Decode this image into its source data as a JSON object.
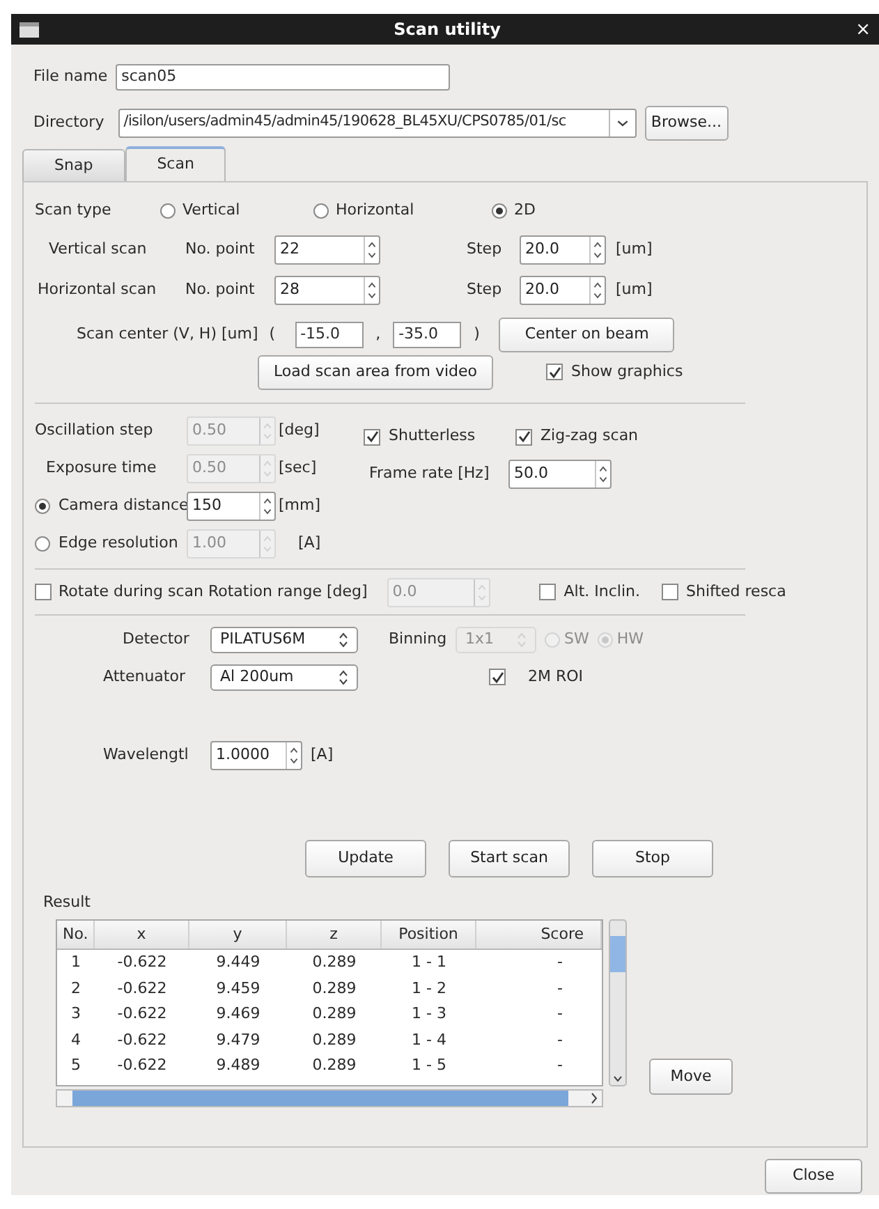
{
  "window": {
    "title": "Scan utility",
    "close": "×"
  },
  "file_name": {
    "label": "File name",
    "value": "scan05"
  },
  "directory": {
    "label": "Directory",
    "value": "/isilon/users/admin45/admin45/190628_BL45XU/CPS0785/01/sc",
    "browse": "Browse..."
  },
  "tabs": [
    {
      "label": "Snap",
      "selected": false
    },
    {
      "label": "Scan",
      "selected": true
    }
  ],
  "scan_type": {
    "label": "Scan type",
    "options": [
      {
        "label": "Vertical",
        "selected": false
      },
      {
        "label": "Horizontal",
        "selected": false
      },
      {
        "label": "2D",
        "selected": true
      }
    ]
  },
  "scan_rows": [
    {
      "label": "Vertical scan",
      "points_label": "No. point",
      "points": "22",
      "step_label": "Step",
      "step": "20.0",
      "unit": "[um]"
    },
    {
      "label": "Horizontal scan",
      "points_label": "No. point",
      "points": "28",
      "step_label": "Step",
      "step": "20.0",
      "unit": "[um]"
    }
  ],
  "scan_center": {
    "label": "Scan center (V, H) [um]",
    "open": "(",
    "v": "-15.0",
    "sep": ",",
    "h": "-35.0",
    "close": ")",
    "button": "Center on beam"
  },
  "load_button": "Load scan area from video",
  "show_graphics": {
    "label": "Show graphics",
    "checked": true
  },
  "params": [
    {
      "kind": "plain",
      "label": "Oscillation step",
      "value": "0.50",
      "unit": "[deg]",
      "disabled": true
    },
    {
      "kind": "plain",
      "label": "Exposure time",
      "value": "0.50",
      "unit": "[sec]",
      "disabled": true
    },
    {
      "kind": "radio",
      "label": "Camera distance",
      "selected": true,
      "value": "150",
      "unit": "[mm]",
      "disabled": false
    },
    {
      "kind": "radio",
      "label": "Edge resolution",
      "selected": false,
      "value": "1.00",
      "unit": "[A]",
      "disabled": true
    }
  ],
  "shutterless": {
    "label": "Shutterless",
    "checked": true
  },
  "zigzag": {
    "label": "Zig-zag scan",
    "checked": true
  },
  "frame_rate": {
    "label": "Frame rate [Hz]",
    "value": "50.0"
  },
  "rotate": {
    "label": "Rotate during scan Rotation range [deg]",
    "checked": false,
    "value": "0.0",
    "disabled": true
  },
  "alt_inclin": {
    "label": "Alt. Inclin.",
    "checked": false
  },
  "shifted": {
    "label": "Shifted resca",
    "checked": false
  },
  "detector": {
    "label": "Detector",
    "value": "PILATUS6M"
  },
  "binning": {
    "label": "Binning",
    "value": "1x1",
    "disabled": true,
    "options": [
      {
        "label": "SW",
        "selected": false
      },
      {
        "label": "HW",
        "selected": true
      }
    ]
  },
  "attenuator": {
    "label": "Attenuator",
    "value": "Al 200um"
  },
  "roi": {
    "label": "2M ROI",
    "checked": true
  },
  "wavelength": {
    "label": "Wavelengtl",
    "value": "1.0000",
    "unit": "[A]"
  },
  "actions": [
    "Update",
    "Start scan",
    "Stop"
  ],
  "result": {
    "label": "Result",
    "columns": [
      "No.",
      "x",
      "y",
      "z",
      "Position",
      "Score"
    ],
    "rows": [
      [
        "1",
        "-0.622",
        "9.449",
        "0.289",
        "1 - 1",
        "-"
      ],
      [
        "2",
        "-0.622",
        "9.459",
        "0.289",
        "1 - 2",
        "-"
      ],
      [
        "3",
        "-0.622",
        "9.469",
        "0.289",
        "1 - 3",
        "-"
      ],
      [
        "4",
        "-0.622",
        "9.479",
        "0.289",
        "1 - 4",
        "-"
      ],
      [
        "5",
        "-0.622",
        "9.489",
        "0.289",
        "1 - 5",
        "-"
      ]
    ],
    "move": "Move"
  },
  "close_button": "Close"
}
